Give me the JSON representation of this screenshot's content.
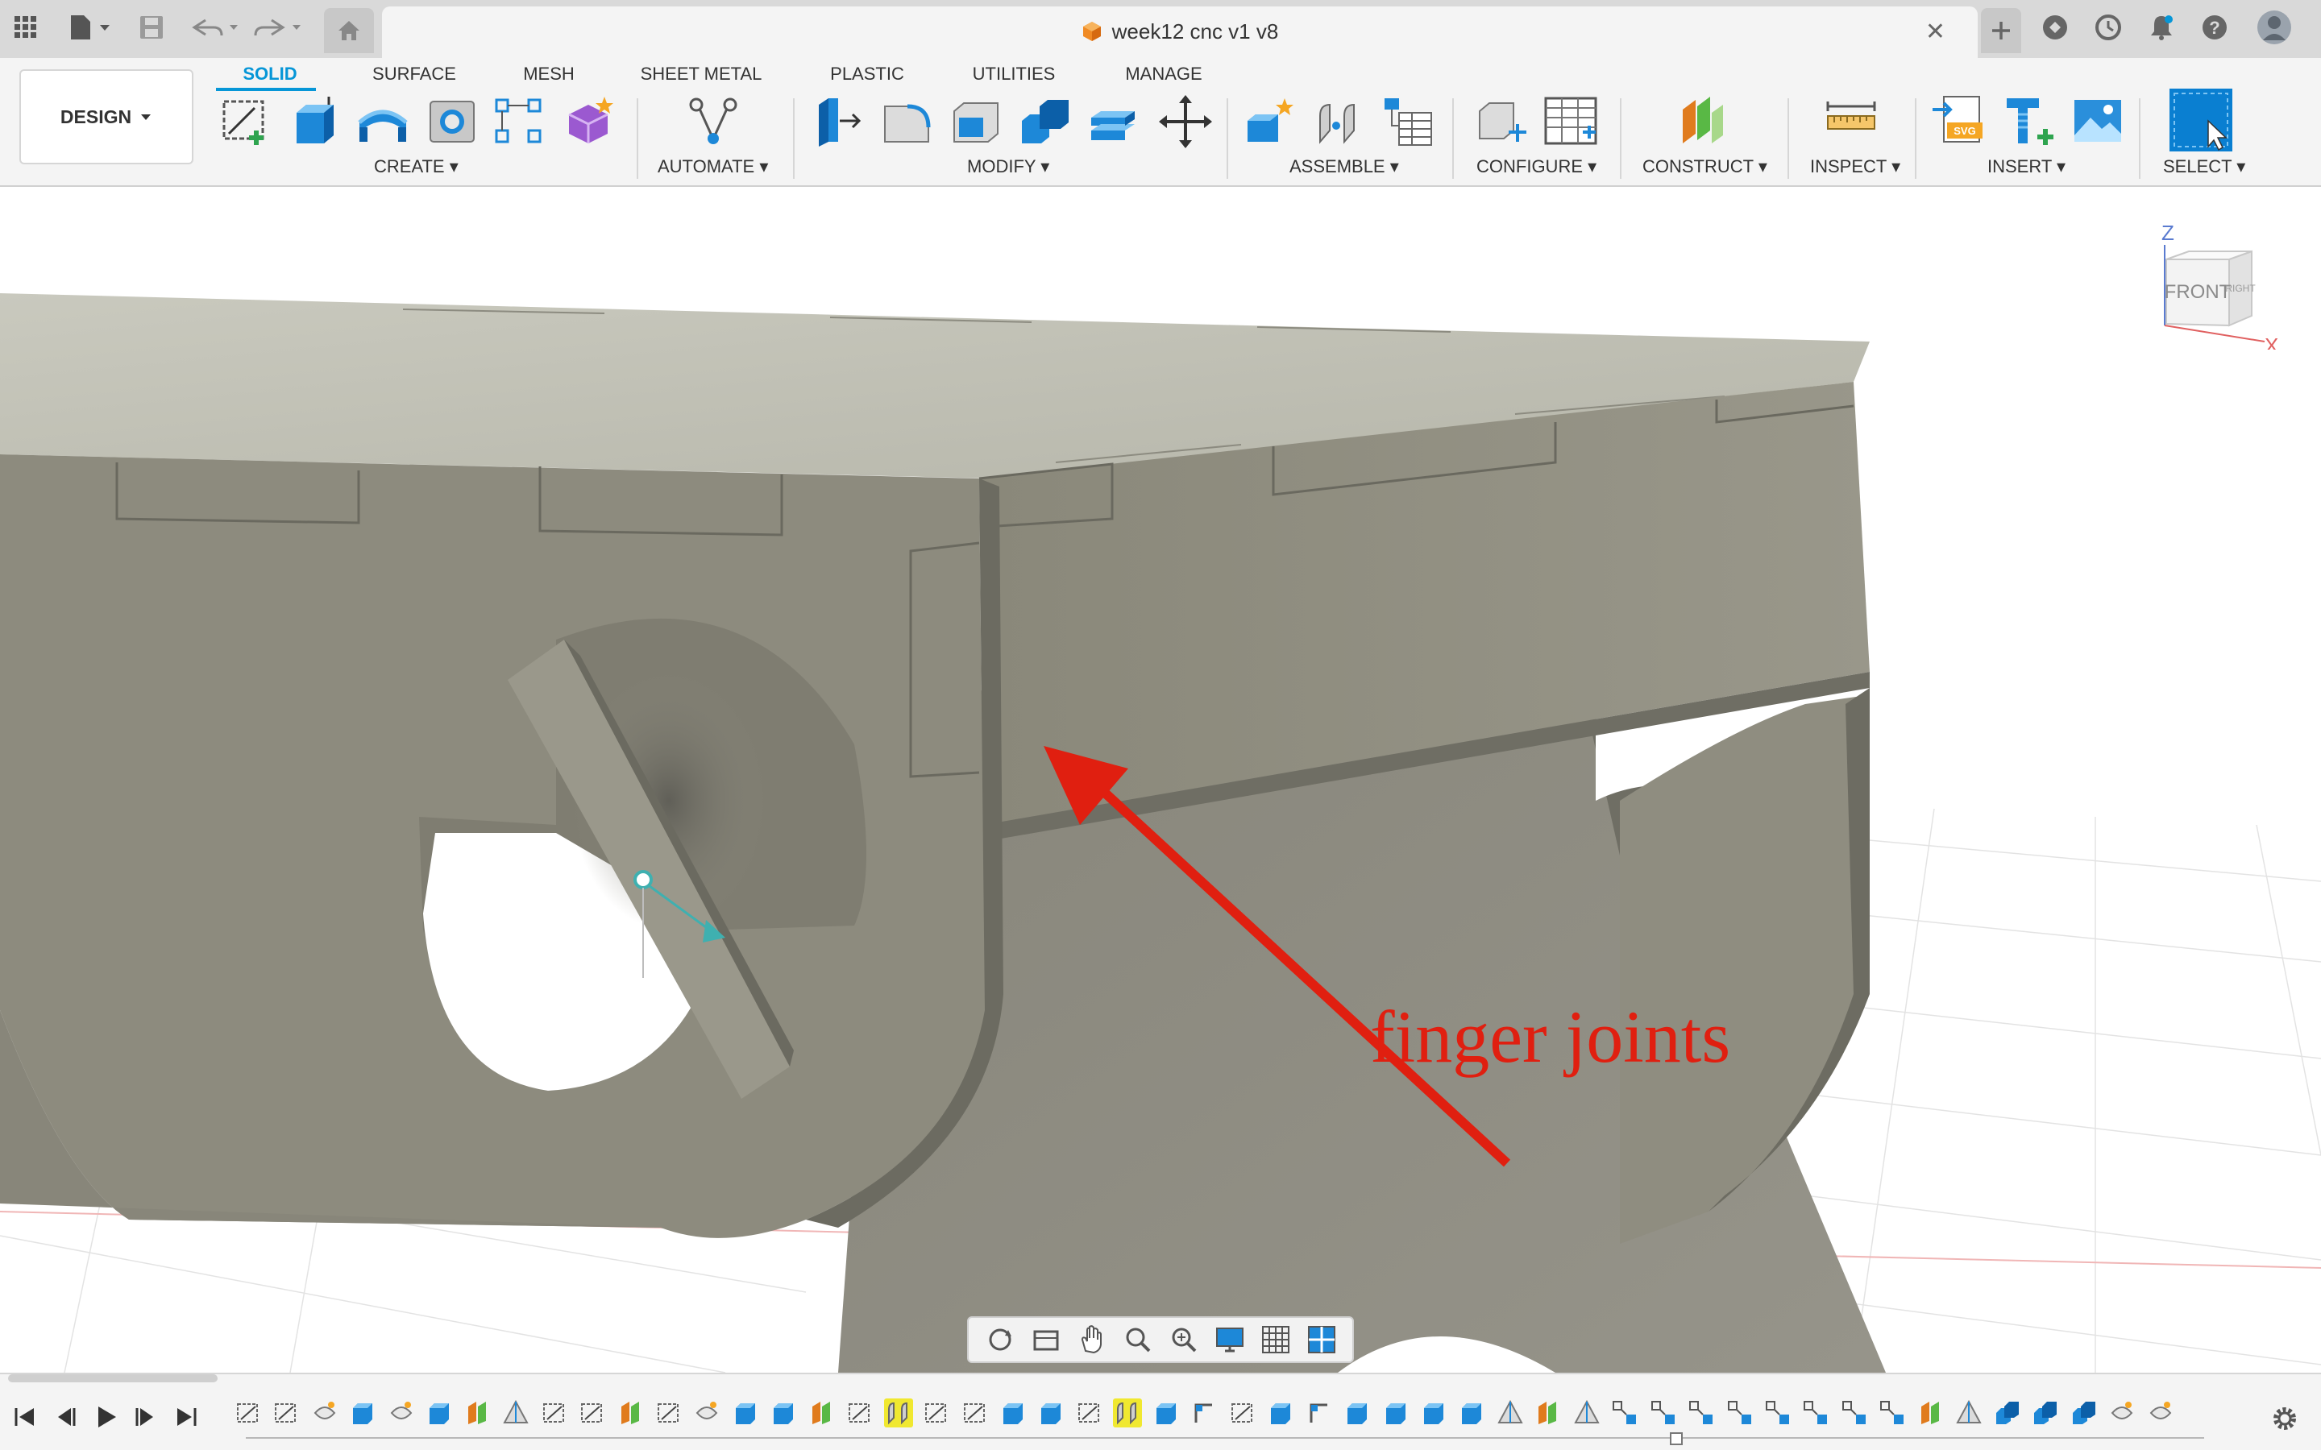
{
  "app": {
    "document_title": "week12 cnc v1 v8",
    "accent_color": "#0696d7"
  },
  "titlebar": {
    "left_icons": [
      "apps-grid-icon",
      "file-menu-icon",
      "save-icon",
      "undo-icon",
      "redo-icon",
      "home-icon"
    ],
    "right_icons": [
      "new-tab-plus-icon",
      "extensions-icon",
      "job-status-icon",
      "notifications-bell-icon",
      "help-icon",
      "user-avatar-icon"
    ]
  },
  "toolbar": {
    "design_label": "DESIGN",
    "tabs": [
      "SOLID",
      "SURFACE",
      "MESH",
      "SHEET METAL",
      "PLASTIC",
      "UTILITIES",
      "MANAGE"
    ],
    "active_tab": "SOLID",
    "groups": {
      "create": "CREATE",
      "automate": "AUTOMATE",
      "modify": "MODIFY",
      "assemble": "ASSEMBLE",
      "configure": "CONFIGURE",
      "construct": "CONSTRUCT",
      "inspect": "INSPECT",
      "insert": "INSERT",
      "select": "SELECT"
    }
  },
  "viewport": {
    "annotation_text": "finger joints",
    "annotation_color": "#e01f10",
    "viewcube": {
      "face_front": "FRONT",
      "face_right": "RIGHT",
      "axis_z": "Z",
      "axis_x": "X"
    },
    "model_color": "#8f8d7f"
  },
  "nav_toolbar": {
    "icons": [
      "orbit-icon",
      "look-at-icon",
      "pan-hand-icon",
      "zoom-icon",
      "fit-zoom-icon",
      "display-settings-icon",
      "grid-settings-icon",
      "viewports-icon"
    ]
  },
  "timeline": {
    "controls": [
      "go-to-start-icon",
      "step-back-icon",
      "play-icon",
      "step-forward-icon",
      "go-to-end-icon"
    ],
    "highlighted_feature_indices": [
      17,
      23
    ],
    "settings_icon": "gear-icon"
  }
}
